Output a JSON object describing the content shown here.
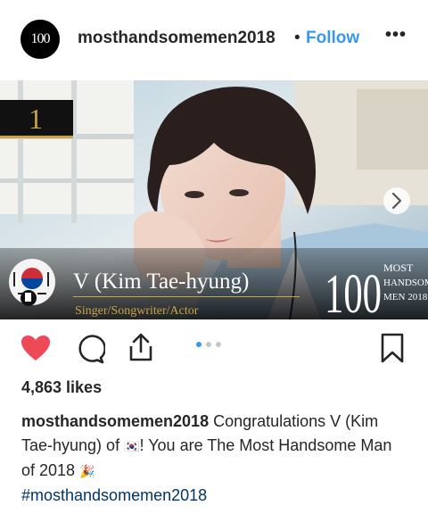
{
  "header": {
    "avatar_logo": "100 MOST HANDSOME MEN",
    "username": "mosthandsomemen2018",
    "separator": "•",
    "follow_label": "Follow",
    "more_label": "•••"
  },
  "photo": {
    "rank": "1",
    "name": "V (Kim Tae-hyung)",
    "subtitle": "Singer/Songwriter/Actor",
    "logo_number": "100",
    "logo_line1": "MOST",
    "logo_line2": "HANDSOME",
    "logo_line3": "MEN 2018",
    "next_icon": "chevron-right-icon"
  },
  "actions": {
    "like_icon": "heart-filled-icon",
    "comment_icon": "comment-icon",
    "share_icon": "share-icon",
    "save_icon": "bookmark-icon",
    "carousel_count": 3,
    "carousel_active": 1
  },
  "likes": "4,863 likes",
  "caption": {
    "username": "mosthandsomemen2018",
    "text_before_flag": " Congratulations V (Kim Tae-hyung) of ",
    "flag_emoji": "🇰🇷",
    "text_after_flag": "! You are The Most Handsome Man of 2018 ",
    "party_emoji": "🎉",
    "hashtag": "#mosthandsomemen2018"
  },
  "colors": {
    "follow_blue": "#3897f0",
    "like_red": "#ed4956",
    "hashtag_blue": "#003569",
    "text_dark": "#262626"
  }
}
